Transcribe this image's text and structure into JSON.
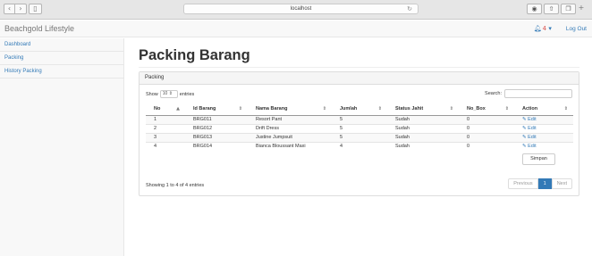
{
  "browser": {
    "address": "localhost",
    "reload_icon": "reload-icon",
    "icons": [
      "info-icon",
      "share-icon",
      "tabs-icon"
    ]
  },
  "navbar": {
    "brand": "Beachgold Lifestyle",
    "notif_count": "4",
    "logout": "Log Out"
  },
  "sidebar": {
    "items": [
      {
        "label": "Dashboard"
      },
      {
        "label": "Packing"
      },
      {
        "label": "History Packing"
      }
    ]
  },
  "main": {
    "title": "Packing Barang",
    "panel_title": "Packing",
    "show_label": "Show",
    "page_length": "10",
    "entries_label": "entries",
    "search_label": "Search:",
    "columns": [
      "No",
      "Id Barang",
      "Nama Barang",
      "Jumlah",
      "Status Jahit",
      "No_Box",
      "Action"
    ],
    "rows": [
      {
        "no": "1",
        "id": "BRG011",
        "nama": "Resort Pant",
        "jumlah": "5",
        "status": "Sudah",
        "box": "0",
        "action": "Edit"
      },
      {
        "no": "2",
        "id": "BRG012",
        "nama": "Drift Dress",
        "jumlah": "5",
        "status": "Sudah",
        "box": "0",
        "action": "Edit"
      },
      {
        "no": "3",
        "id": "BRG013",
        "nama": "Justine Jumpsuit",
        "jumlah": "5",
        "status": "Sudah",
        "box": "0",
        "action": "Edit"
      },
      {
        "no": "4",
        "id": "BRG014",
        "nama": "Bianca Bloussant Maxi",
        "jumlah": "4",
        "status": "Sudah",
        "box": "0",
        "action": "Edit"
      }
    ],
    "simpan_label": "Simpan",
    "info": "Showing 1 to 4 of 4 entries",
    "pagination": {
      "previous": "Previous",
      "current": "1",
      "next": "Next"
    }
  },
  "colors": {
    "accent": "#337ab7",
    "badge": "#d9534f"
  }
}
